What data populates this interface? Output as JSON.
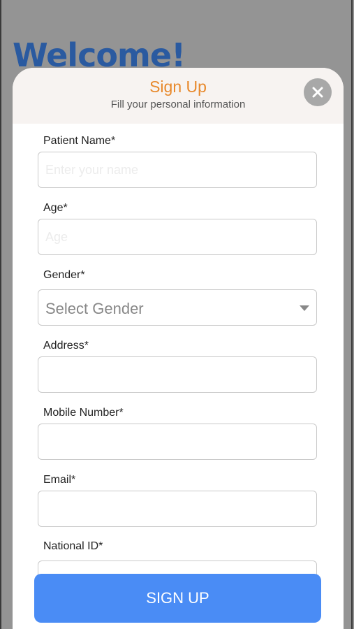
{
  "background": {
    "welcome_text": "Welcome!"
  },
  "modal": {
    "title": "Sign Up",
    "subtitle": "Fill your personal information",
    "close_icon": "close-icon"
  },
  "form": {
    "patient_name": {
      "label": "Patient Name*",
      "placeholder": "Enter your name"
    },
    "age": {
      "label": "Age*",
      "placeholder": "Age"
    },
    "gender": {
      "label": "Gender*",
      "selected": "Select Gender"
    },
    "address": {
      "label": "Address*",
      "value": ""
    },
    "mobile": {
      "label": "Mobile Number*",
      "value": ""
    },
    "email": {
      "label": "Email*",
      "value": ""
    },
    "national_id": {
      "label": "National ID*",
      "value": ""
    }
  },
  "submit": {
    "label": "SIGN UP"
  },
  "colors": {
    "accent_orange": "#e8892c",
    "button_blue": "#4a8cf5",
    "welcome_blue": "#2a5aa0"
  }
}
